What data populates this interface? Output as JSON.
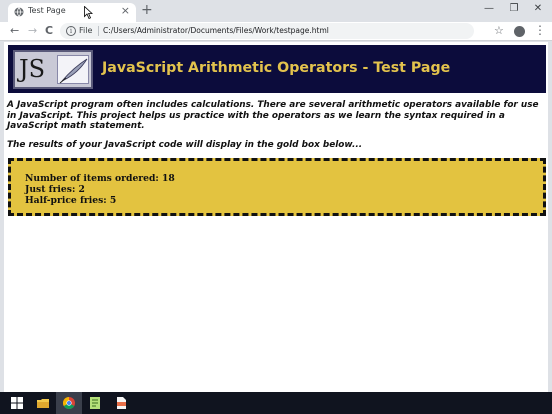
{
  "browser": {
    "tab_title": "Test Page",
    "tab_close": "×",
    "new_tab": "+",
    "minimize": "—",
    "restore": "❐",
    "close_window": "✕",
    "back": "←",
    "forward": "→",
    "reload": "C",
    "info": "i",
    "scheme_label": "File",
    "url": "C:/Users/Administrator/Documents/Files/Work/testpage.html",
    "star": "☆",
    "menu": "⋮"
  },
  "page": {
    "logo_text": "JS",
    "title": "JavaScript Arithmetic Operators - Test Page",
    "intro": "A JavaScript program often includes calculations. There are several arithmetic operators available for use in JavaScript. This project helps us practice with the operators as we learn the syntax required in a JavaScript math statement.",
    "lead": "The results of your JavaScript code will display in the gold box below...",
    "output_lines": [
      "Number of items ordered: 18",
      "Just fries: 2",
      "Half-price fries: 5"
    ]
  },
  "taskbar": {
    "icons": [
      "windows-start-icon",
      "file-explorer-icon",
      "chrome-icon",
      "notepad-plus-plus-icon",
      "document-icon"
    ]
  },
  "colors": {
    "banner": "#0c0c3c",
    "title_gold": "#e3c34d",
    "gold_box": "#e3c340",
    "taskbar": "#10141f"
  }
}
